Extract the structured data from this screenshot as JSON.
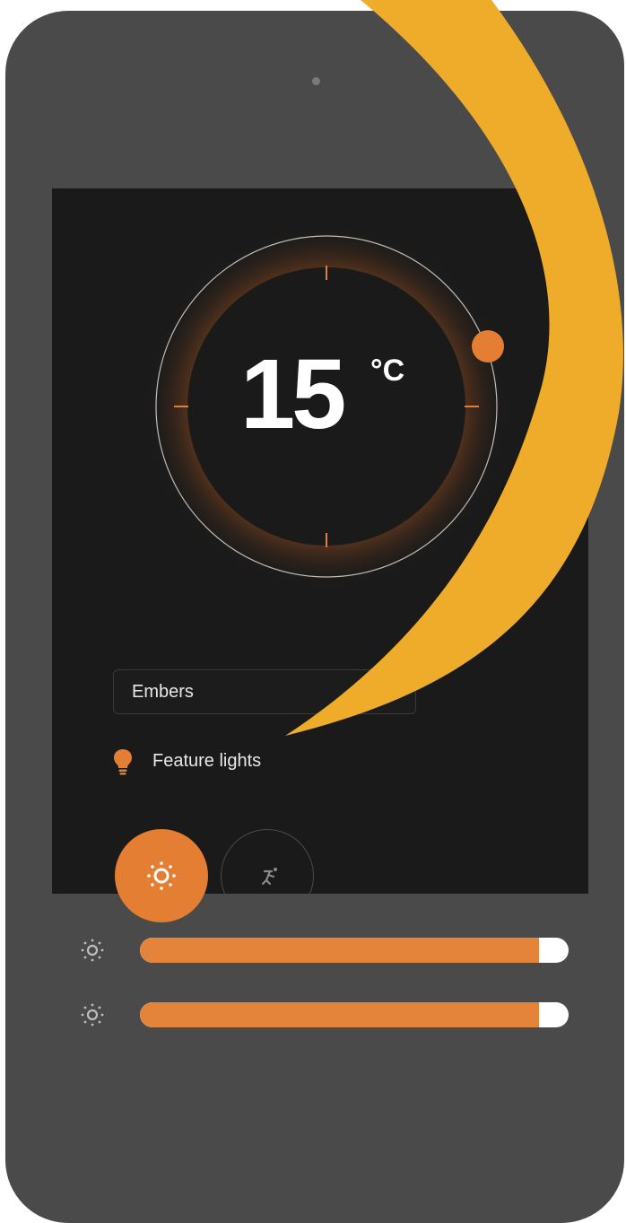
{
  "thermostat": {
    "temperature": "15",
    "unit": "°C"
  },
  "mode_select": {
    "selected": "Embers"
  },
  "feature_lights": {
    "label": "Feature lights"
  },
  "buttons": {
    "light_mode_icon": "sun-icon",
    "motion_mode_icon": "running-figure-icon"
  },
  "sliders": [
    {
      "icon": "brightness-icon",
      "level_percent": 93
    },
    {
      "icon": "brightness-icon",
      "level_percent": 93
    }
  ],
  "colors": {
    "accent": "#e47e32",
    "screen_bg": "#1a1a1a",
    "device_body": "#4a4a4a",
    "callout_swoosh": "#eeac2a"
  }
}
